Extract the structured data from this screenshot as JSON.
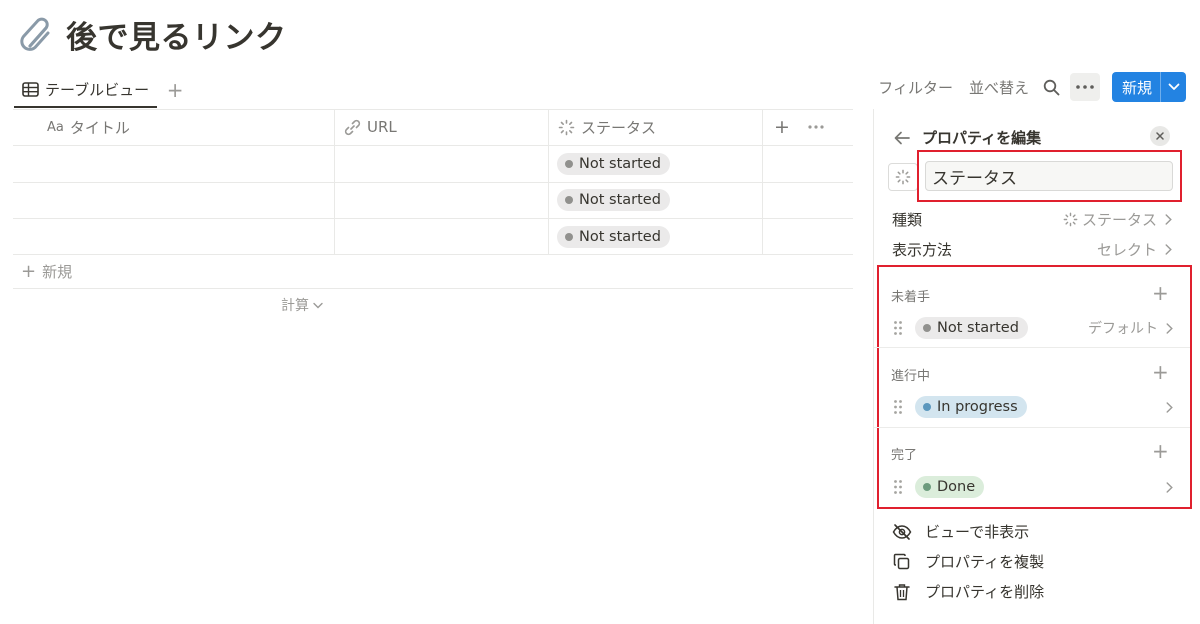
{
  "page": {
    "title": "後で見るリンク",
    "icon": "paperclip-icon"
  },
  "view_tabs": {
    "active_label": "テーブルビュー",
    "add_label": "+"
  },
  "toolbar": {
    "filter_label": "フィルター",
    "sort_label": "並べ替え",
    "new_label": "新規"
  },
  "table": {
    "columns": [
      {
        "prefix": "Aa",
        "label": "タイトル",
        "icon": "text-icon"
      },
      {
        "label": "URL",
        "icon": "link-icon"
      },
      {
        "label": "ステータス",
        "icon": "status-icon"
      }
    ],
    "rows": [
      {
        "title": "",
        "url": "",
        "status": "Not started"
      },
      {
        "title": "",
        "url": "",
        "status": "Not started"
      },
      {
        "title": "",
        "url": "",
        "status": "Not started"
      }
    ],
    "new_row_label": "新規",
    "calculate_label": "計算"
  },
  "panel": {
    "title": "プロパティを編集",
    "property_name": "ステータス",
    "type_label": "種類",
    "type_value": "ステータス",
    "display_label": "表示方法",
    "display_value": "セレクト",
    "groups": [
      {
        "label": "未着手",
        "option": "Not started",
        "note": "デフォルト",
        "color": "#91918e"
      },
      {
        "label": "進行中",
        "option": "In progress",
        "note": "",
        "color": "#5b97bd"
      },
      {
        "label": "完了",
        "option": "Done",
        "note": "",
        "color": "#6c9b7d"
      }
    ],
    "actions": {
      "hide": "ビューで非表示",
      "duplicate": "プロパティを複製",
      "delete": "プロパティを削除"
    }
  },
  "colors": {
    "accent": "#2383e2",
    "highlight_box": "#e0202e"
  }
}
